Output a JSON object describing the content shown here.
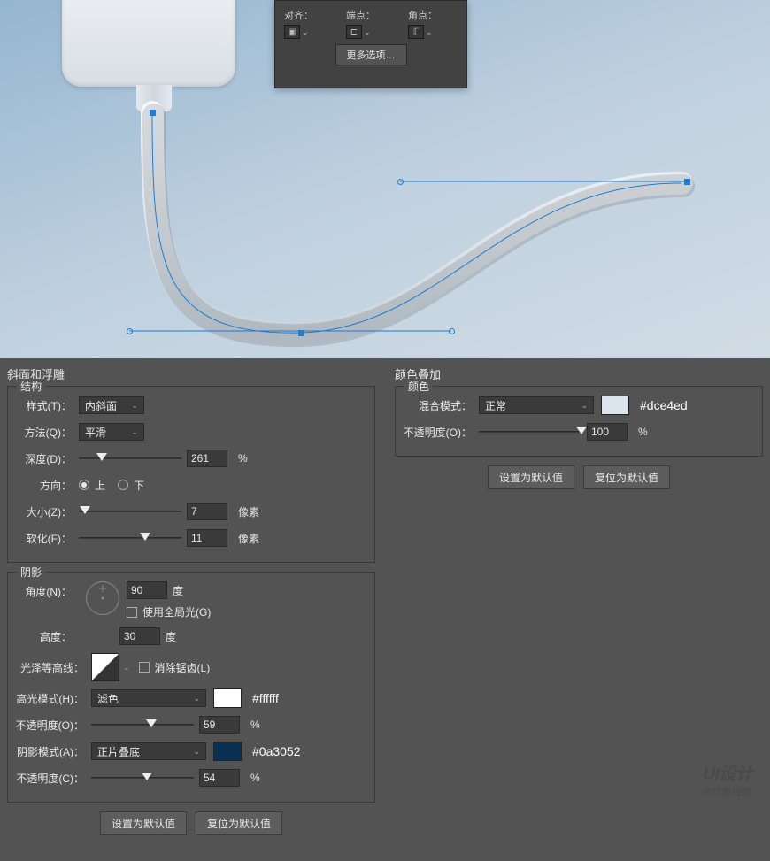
{
  "strokePanel": {
    "col1_label": "对齐：",
    "col2_label": "端点：",
    "col3_label": "角点：",
    "moreOptions": "更多选项…"
  },
  "bevel": {
    "title": "斜面和浮雕",
    "structure": "结构",
    "styleLabel": "样式(T)：",
    "styleValue": "内斜面",
    "methodLabel": "方法(Q)：",
    "methodValue": "平滑",
    "depthLabel": "深度(D)：",
    "depthValue": "261",
    "depthSuffix": "%",
    "directionLabel": "方向：",
    "dirUp": "上",
    "dirDown": "下",
    "sizeLabel": "大小(Z)：",
    "sizeValue": "7",
    "sizeSuffix": "像素",
    "softenLabel": "软化(F)：",
    "softenValue": "11",
    "softenSuffix": "像素",
    "shadow": "阴影",
    "angleLabel": "角度(N)：",
    "angleValue": "90",
    "angleSuffix": "度",
    "globalLight": "使用全局光(G)",
    "altLabel": "高度：",
    "altValue": "30",
    "altSuffix": "度",
    "glossLabel": "光泽等高线：",
    "antialias": "消除锯齿(L)",
    "highlightModeLabel": "高光模式(H)：",
    "highlightModeValue": "滤色",
    "highlightHex": "#ffffff",
    "highlightOpacityLabel": "不透明度(O)：",
    "highlightOpacity": "59",
    "shadowModeLabel": "阴影模式(A)：",
    "shadowModeValue": "正片叠底",
    "shadowHex": "#0a3052",
    "shadowOpacityLabel": "不透明度(C)：",
    "shadowOpacity": "54",
    "pctSuffix": "%",
    "setDefault": "设置为默认值",
    "resetDefault": "复位为默认值"
  },
  "colorOverlay": {
    "title": "颜色叠加",
    "group": "颜色",
    "blendLabel": "混合模式：",
    "blendValue": "正常",
    "blendHex": "#dce4ed",
    "opacityLabel": "不透明度(O)：",
    "opacityValue": "100",
    "pctSuffix": "%",
    "setDefault": "设置为默认值",
    "resetDefault": "复位为默认值"
  },
  "watermark": {
    "main": "UI设计",
    "sub": "优优教程网"
  },
  "colors": {
    "highlightSwatch": "#ffffff",
    "shadowSwatch": "#0a3052",
    "overlaySwatch": "#dce4ed"
  }
}
